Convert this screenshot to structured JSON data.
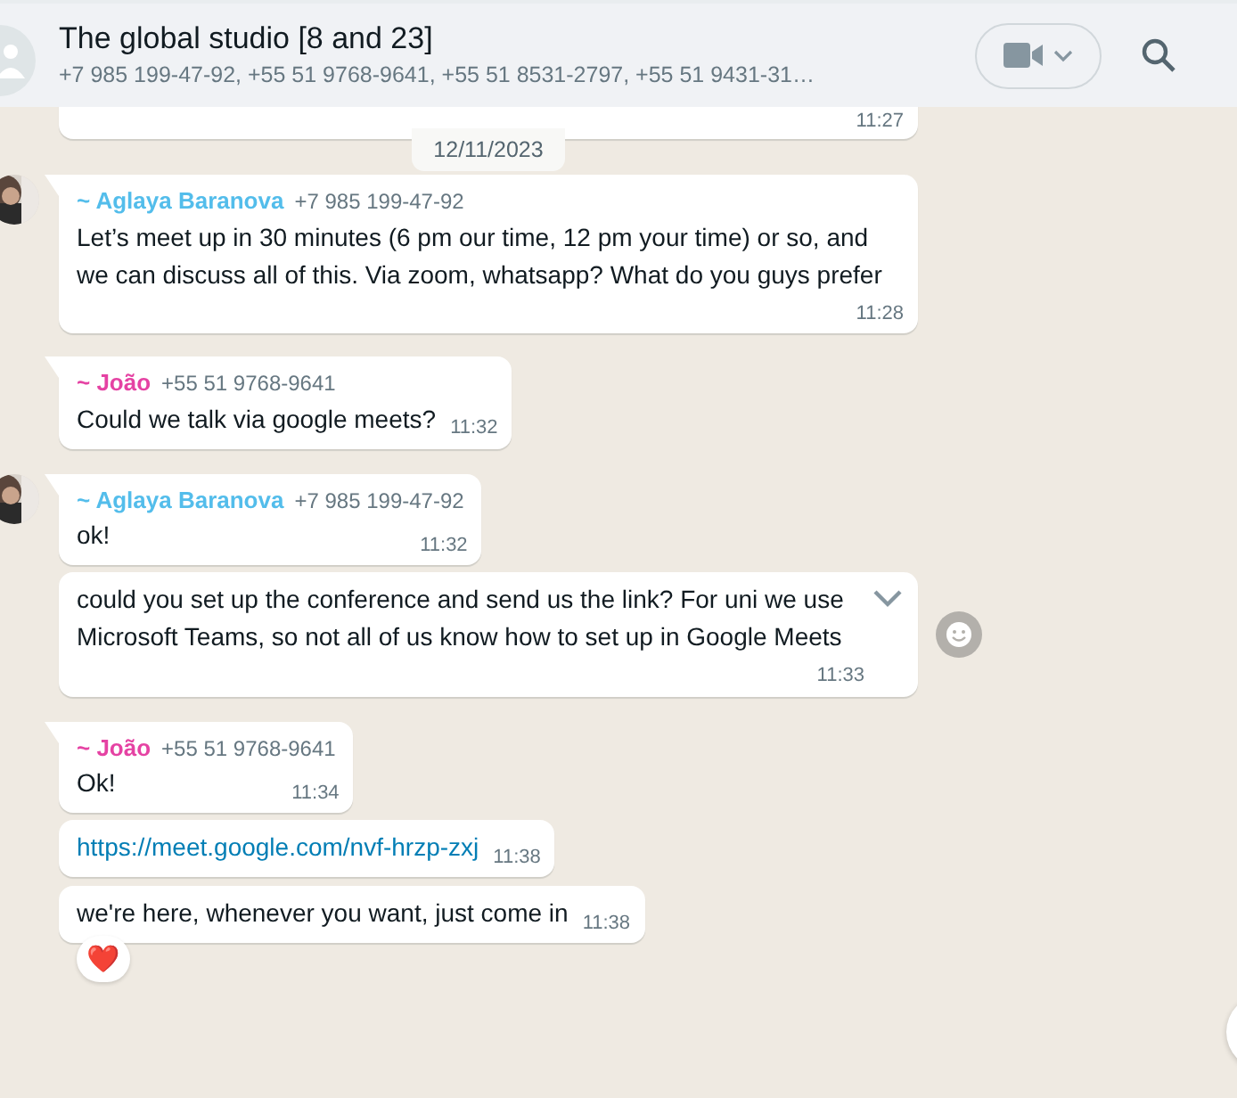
{
  "header": {
    "title": "The global studio [8 and 23]",
    "subtitle": "+7 985 199-47-92, +55 51 9768-9641, +55 51 8531-2797, +55 51 9431-31…"
  },
  "messages": [
    {
      "kind": "cut",
      "time": "11:27"
    },
    {
      "kind": "date",
      "text": "12/11/2023"
    },
    {
      "kind": "message",
      "avatar": true,
      "tail": true,
      "sender": {
        "name": "~ Aglaya Baranova",
        "phone": "+7 985 199-47-92",
        "color": "#53bdeb"
      },
      "text": "Let’s meet up in 30 minutes (6 pm our time, 12 pm your time) or so, and we can discuss all of this. Via zoom, whatsapp? What do you guys prefer",
      "time": "11:28"
    },
    {
      "kind": "message",
      "avatar": false,
      "tail": true,
      "sender": {
        "name": "~ João",
        "phone": "+55 51 9768-9641",
        "color": "#e542a3"
      },
      "text": "Could we talk via google meets?",
      "time": "11:32"
    },
    {
      "kind": "message",
      "avatar": true,
      "tail": true,
      "sender": {
        "name": "~ Aglaya Baranova",
        "phone": "+7 985 199-47-92",
        "color": "#53bdeb"
      },
      "text": "ok!",
      "time": "11:32"
    },
    {
      "kind": "message",
      "avatar": false,
      "tail": false,
      "hovered": true,
      "text": "could you set up the conference and send us the link? For uni we use Microsoft Teams, so not all of us know how to set up in Google Meets",
      "time": "11:33"
    },
    {
      "kind": "message",
      "avatar": false,
      "tail": true,
      "sender": {
        "name": "~ João",
        "phone": "+55 51 9768-9641",
        "color": "#e542a3"
      },
      "text": "Ok!",
      "time": "11:34"
    },
    {
      "kind": "link",
      "avatar": false,
      "tail": false,
      "text": "https://meet.google.com/nvf-hrzp-zxj",
      "time": "11:38"
    },
    {
      "kind": "message",
      "avatar": false,
      "tail": false,
      "text": "we're here, whenever you want, just come in",
      "time": "11:38",
      "reaction": "❤️"
    }
  ]
}
